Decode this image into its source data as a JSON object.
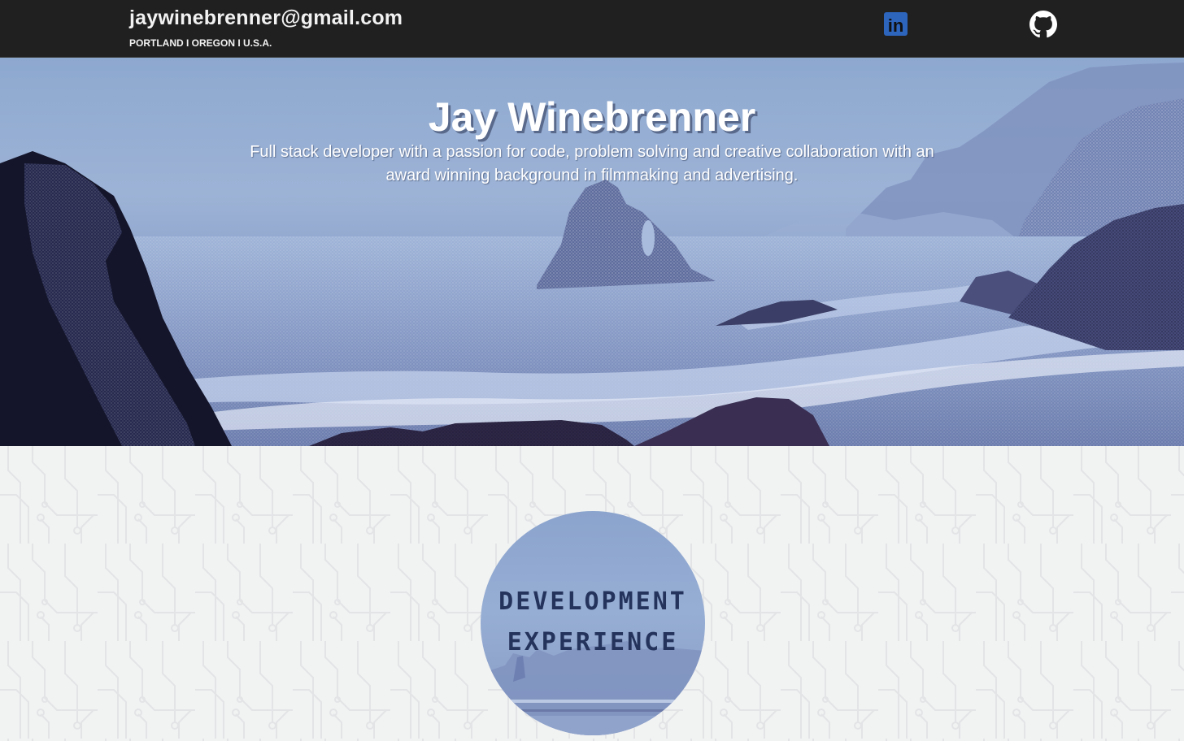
{
  "header": {
    "email": "jaywinebrenner@gmail.com",
    "location": "PORTLAND I OREGON I U.S.A.",
    "linkedin_label": "in",
    "linkedin_icon": "linkedin-icon",
    "github_icon": "github-icon"
  },
  "hero": {
    "name": "Jay Winebrenner",
    "tagline": "Full stack developer with a passion for code, problem solving and creative collaboration with an award winning background in filmmaking and advertising."
  },
  "section": {
    "badge_line_1": "DEVELOPMENT",
    "badge_line_2": "EXPERIENCE"
  },
  "colors": {
    "header_bg": "#202020",
    "linkedin_blue": "#2d64bc",
    "hero_sky": "#8da8cf",
    "badge_text": "#24335b",
    "content_bg": "#f1f2f2"
  }
}
